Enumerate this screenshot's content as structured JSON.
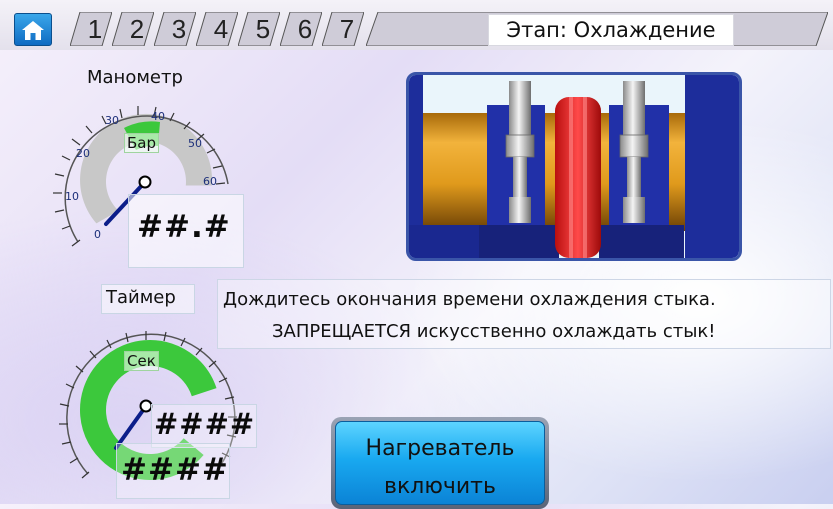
{
  "topbar": {
    "tabs": [
      "1",
      "2",
      "3",
      "4",
      "5",
      "6",
      "7"
    ],
    "stage_label": "Этап: Охлаждение"
  },
  "manometer": {
    "title": "Манометр",
    "unit": "Бар",
    "readout": "##.#",
    "scale_labels": [
      "0",
      "10",
      "20",
      "30",
      "40",
      "50",
      "60"
    ],
    "level_fraction": 0.55
  },
  "timer": {
    "title": "Таймер",
    "unit": "Сек",
    "readout_upper": "####",
    "readout_lower": "####"
  },
  "message": {
    "line1": "Дождитесь окончания времени охлаждения стыка.",
    "line2": "ЗАПРЕЩАЕТСЯ искусственно охлаждать стык!"
  },
  "heater_button": {
    "line1": "Нагреватель",
    "line2": "включить"
  },
  "icons": {
    "home": "home-icon",
    "illustration": "pipe-welding-clamp-illustration"
  },
  "colors": {
    "home_button": "#1d86d8",
    "gauge_green": "#3cc83c",
    "gauge_gray": "#c8c8c8",
    "photo_border": "#3a55a8",
    "heater_button": "#19a9f0",
    "weld_ring": "#e32222"
  }
}
